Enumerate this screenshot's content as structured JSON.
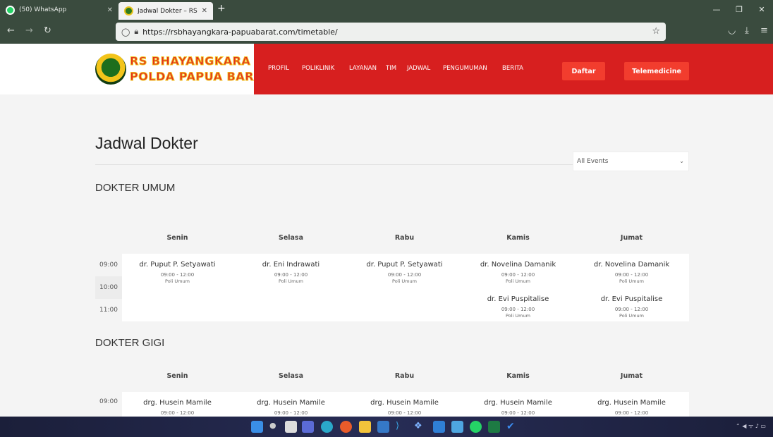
{
  "browser": {
    "tabs": [
      {
        "title": "(50) WhatsApp",
        "active": false
      },
      {
        "title": "Jadwal Dokter – RS Bhayangka",
        "active": true
      }
    ],
    "url": "https://rsbhayangkara-papuabarat.com/timetable/"
  },
  "site": {
    "logo_line1": "RS BHAYANGKARA",
    "logo_line2": "POLDA PAPUA BARAT",
    "menu": [
      "PROFIL",
      "POLIKLINIK",
      "LAYANAN",
      "TIM",
      "JADWAL",
      "PENGUMUMAN",
      "BERITA"
    ],
    "btn_daftar": "Daftar",
    "btn_telemedicine": "Telemedicine",
    "brand_color": "#d71f1f"
  },
  "page": {
    "title": "Jadwal Dokter",
    "filter_value": "All Events"
  },
  "days": [
    "Senin",
    "Selasa",
    "Rabu",
    "Kamis",
    "Jumat"
  ],
  "sections": [
    {
      "title": "DOKTER UMUM",
      "times": [
        "09:00",
        "10:00",
        "11:00"
      ],
      "entries": [
        [
          {
            "name": "dr. Puput P. Setyawati",
            "time": "09:00 - 12:00",
            "poli": "Poli Umum"
          }
        ],
        [
          {
            "name": "dr. Eni Indrawati",
            "time": "09:00 - 12:00",
            "poli": "Poli Umum"
          }
        ],
        [
          {
            "name": "dr. Puput P. Setyawati",
            "time": "09:00 - 12:00",
            "poli": "Poli Umum"
          }
        ],
        [
          {
            "name": "dr. Novelina Damanik",
            "time": "09:00 - 12:00",
            "poli": "Poli Umum"
          },
          {
            "name": "dr. Evi Puspitalise",
            "time": "09:00 - 12:00",
            "poli": "Poli Umum"
          }
        ],
        [
          {
            "name": "dr. Novelina Damanik",
            "time": "09:00 - 12:00",
            "poli": "Poli Umum"
          },
          {
            "name": "dr. Evi Puspitalise",
            "time": "09:00 - 12:00",
            "poli": "Poli Umum"
          }
        ]
      ]
    },
    {
      "title": "DOKTER GIGI",
      "times": [
        "09:00"
      ],
      "entries": [
        [
          {
            "name": "drg. Husein Mamile",
            "time": "09:00 - 12:00"
          }
        ],
        [
          {
            "name": "drg. Husein Mamile",
            "time": "09:00 - 12:00"
          }
        ],
        [
          {
            "name": "drg. Husein Mamile",
            "time": "09:00 - 12:00"
          }
        ],
        [
          {
            "name": "drg. Husein Mamile",
            "time": "09:00 - 12:00"
          }
        ],
        [
          {
            "name": "drg. Husein Mamile",
            "time": "09:00 - 12:00"
          }
        ]
      ]
    }
  ]
}
